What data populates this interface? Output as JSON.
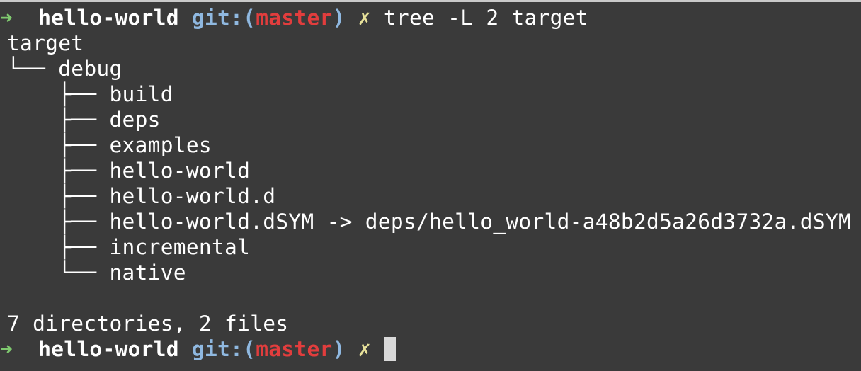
{
  "prompt": {
    "arrow_icon": "➜",
    "directory": "hello-world",
    "git_prefix": "git:(",
    "branch": "master",
    "git_suffix": ")",
    "dirty_marker": "✗"
  },
  "command": "tree -L 2 target",
  "output": {
    "root": "target",
    "children": [
      {
        "connector": "└── ",
        "name": "debug",
        "children": [
          {
            "connector": "├── ",
            "name": "build"
          },
          {
            "connector": "├── ",
            "name": "deps"
          },
          {
            "connector": "├── ",
            "name": "examples"
          },
          {
            "connector": "├── ",
            "name": "hello-world"
          },
          {
            "connector": "├── ",
            "name": "hello-world.d"
          },
          {
            "connector": "├── ",
            "name": "hello-world.dSYM -> deps/hello_world-a48b2d5a26d3732a.dSYM"
          },
          {
            "connector": "├── ",
            "name": "incremental"
          },
          {
            "connector": "└── ",
            "name": "native"
          }
        ]
      }
    ],
    "summary": "7 directories, 2 files"
  },
  "colors": {
    "background": "#3a3a3a",
    "arrow": "#7fc96f",
    "git_label": "#8fb8e0",
    "branch": "#e23d3d",
    "dirty": "#e8e29a"
  }
}
